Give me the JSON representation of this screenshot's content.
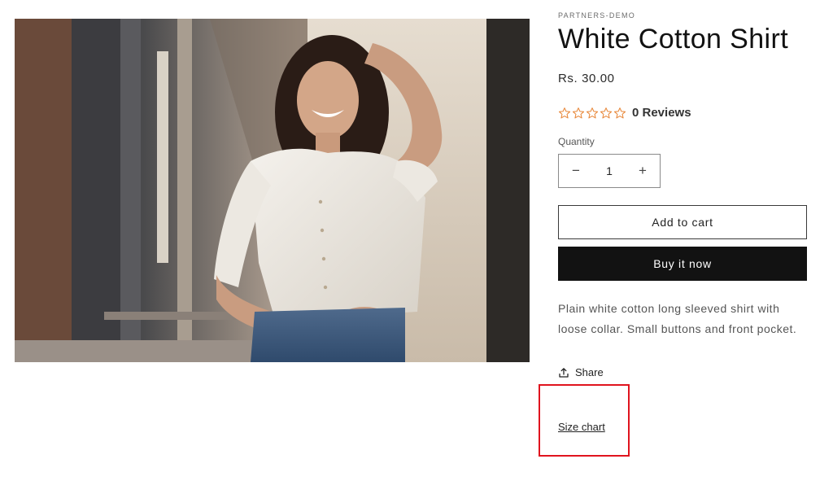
{
  "product": {
    "vendor": "PARTNERS-DEMO",
    "title": "White Cotton Shirt",
    "price": "Rs. 30.00",
    "rating": {
      "stars_total": 5,
      "stars_filled": 0,
      "reviews_label": "0 Reviews",
      "star_color": "#e8893c"
    },
    "quantity": {
      "label": "Quantity",
      "value": "1",
      "decrement_symbol": "−",
      "increment_symbol": "+"
    },
    "add_to_cart_label": "Add to cart",
    "buy_now_label": "Buy it now",
    "description": "Plain white cotton long sleeved shirt with loose collar. Small buttons and front pocket.",
    "share_label": "Share",
    "size_chart_label": "Size chart"
  },
  "image": {
    "subject": "woman-in-white-shirt-photo"
  },
  "highlight": {
    "color": "#e0141e"
  }
}
